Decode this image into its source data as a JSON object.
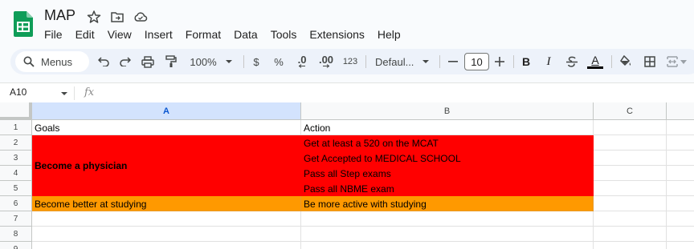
{
  "app": {
    "doc_title": "MAP",
    "brand_color": "#0f9d58"
  },
  "menu": {
    "items": [
      "File",
      "Edit",
      "View",
      "Insert",
      "Format",
      "Data",
      "Tools",
      "Extensions",
      "Help"
    ]
  },
  "toolbar": {
    "menus_label": "Menus",
    "zoom": "100%",
    "currency": "$",
    "percent": "%",
    "dec_decrease": ".0",
    "dec_increase": ".00",
    "number_format": "123",
    "font_family": "Defaul...",
    "font_size": "10",
    "bold": "B",
    "italic": "I",
    "text_color_letter": "A"
  },
  "formula_bar": {
    "cell_ref": "A10",
    "fx_label": "fx",
    "value": ""
  },
  "sheet": {
    "columns": [
      "A",
      "B",
      "C"
    ],
    "selected_column": "A",
    "rows": [
      "1",
      "2",
      "3",
      "4",
      "5",
      "6",
      "7",
      "8",
      "9"
    ],
    "cells": {
      "A1": "Goals",
      "B1": "Action",
      "A2_5": "Become a physician",
      "B2": "Get at least a 520 on the MCAT",
      "B3": "Get Accepted to MEDICAL SCHOOL",
      "B4": "Pass all Step exams",
      "B5": "Pass all NBME exam",
      "A6": "Become better at studying",
      "B6": "Be more active with studying"
    },
    "fill_colors": {
      "physician_rows": "#ff0000",
      "studying_row": "#ff9900"
    }
  }
}
